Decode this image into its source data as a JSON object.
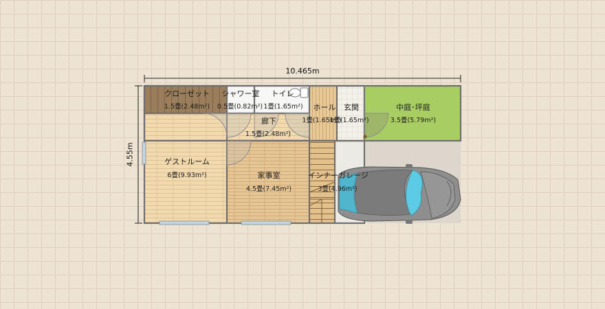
{
  "dimensions": {
    "width": "10.465m",
    "depth": "4.55m"
  },
  "rooms": [
    {
      "id": "closet",
      "name": "クローゼット",
      "area": "1.5畳(2.48m²)"
    },
    {
      "id": "shower",
      "name": "シャワー室",
      "area": "0.5畳(0.82m²)"
    },
    {
      "id": "toilet",
      "name": "トイレ",
      "area": "1畳(1.65m²)"
    },
    {
      "id": "hall",
      "name": "ホール",
      "area": "1畳(1.65m²)"
    },
    {
      "id": "entrance",
      "name": "玄関",
      "area": "1畳(1.65m²)"
    },
    {
      "id": "courtyard",
      "name": "中庭･坪庭",
      "area": "3.5畳(5.79m²)"
    },
    {
      "id": "corridor",
      "name": "廊下",
      "area": "1.5畳(2.48m²)"
    },
    {
      "id": "guestroom",
      "name": "ゲストルーム",
      "area": "6畳(9.93m²)"
    },
    {
      "id": "utility",
      "name": "家事室",
      "area": "4.5畳(7.45m²)"
    },
    {
      "id": "garage",
      "name": "インナーガレージ",
      "area": "3畳(4.96m²)"
    }
  ],
  "colors": {
    "background": "#ece3d3",
    "grid": "#dccfbd",
    "floor_wood": "#e3c290",
    "floor_wood_light": "#f0d9ae",
    "closet_floor": "#9a7e5c",
    "courtyard": "#a8cd62",
    "wall": "#6e6e6e",
    "car_body": "#8a8a8a",
    "car_glass": "#58c8e0"
  }
}
